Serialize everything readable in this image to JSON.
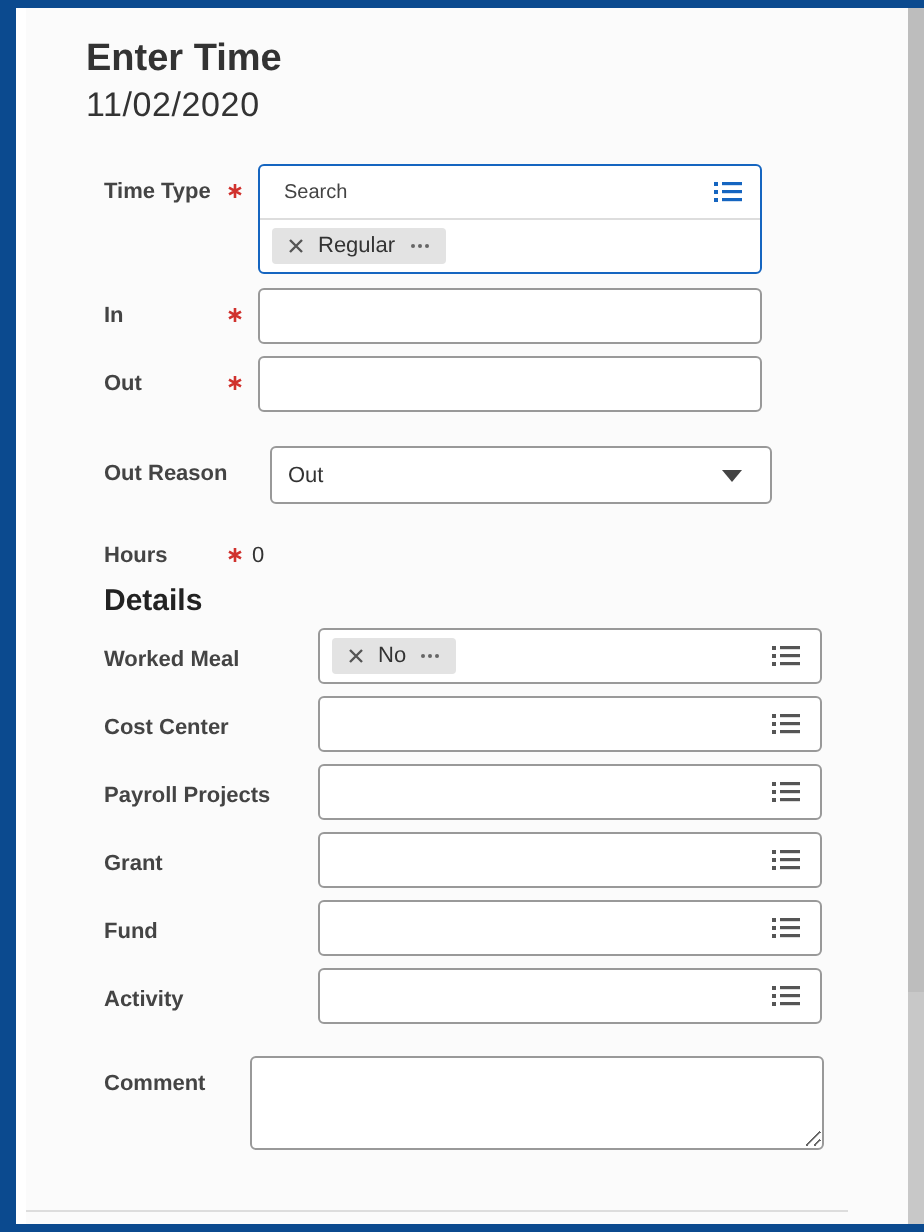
{
  "header": {
    "title": "Enter Time",
    "date": "11/02/2020"
  },
  "sections": [
    {
      "fields": [
        {
          "kind": "multiselect",
          "label": "Time Type",
          "required": true,
          "focused": true,
          "placeholder": "Search",
          "chips": [
            "Regular"
          ]
        },
        {
          "kind": "text",
          "label": "In",
          "required": true
        },
        {
          "kind": "text",
          "label": "Out",
          "required": true
        }
      ]
    },
    {
      "fields": [
        {
          "kind": "select",
          "label": "Out Reason",
          "required": false,
          "value": "Out"
        }
      ]
    },
    {
      "fields": [
        {
          "kind": "readonly",
          "label": "Hours",
          "required": true,
          "value": "0"
        }
      ]
    },
    {
      "heading": "Details",
      "fields": [
        {
          "kind": "prompt",
          "label": "Worked Meal",
          "required": false,
          "chips": [
            "No"
          ]
        },
        {
          "kind": "prompt",
          "label": "Cost Center",
          "required": false
        },
        {
          "kind": "prompt",
          "label": "Payroll Projects",
          "required": false
        },
        {
          "kind": "prompt",
          "label": "Grant",
          "required": false
        },
        {
          "kind": "prompt",
          "label": "Fund",
          "required": false
        },
        {
          "kind": "prompt",
          "label": "Activity",
          "required": false
        }
      ]
    },
    {
      "fields": [
        {
          "kind": "textarea",
          "label": "Comment",
          "required": false
        }
      ]
    }
  ]
}
